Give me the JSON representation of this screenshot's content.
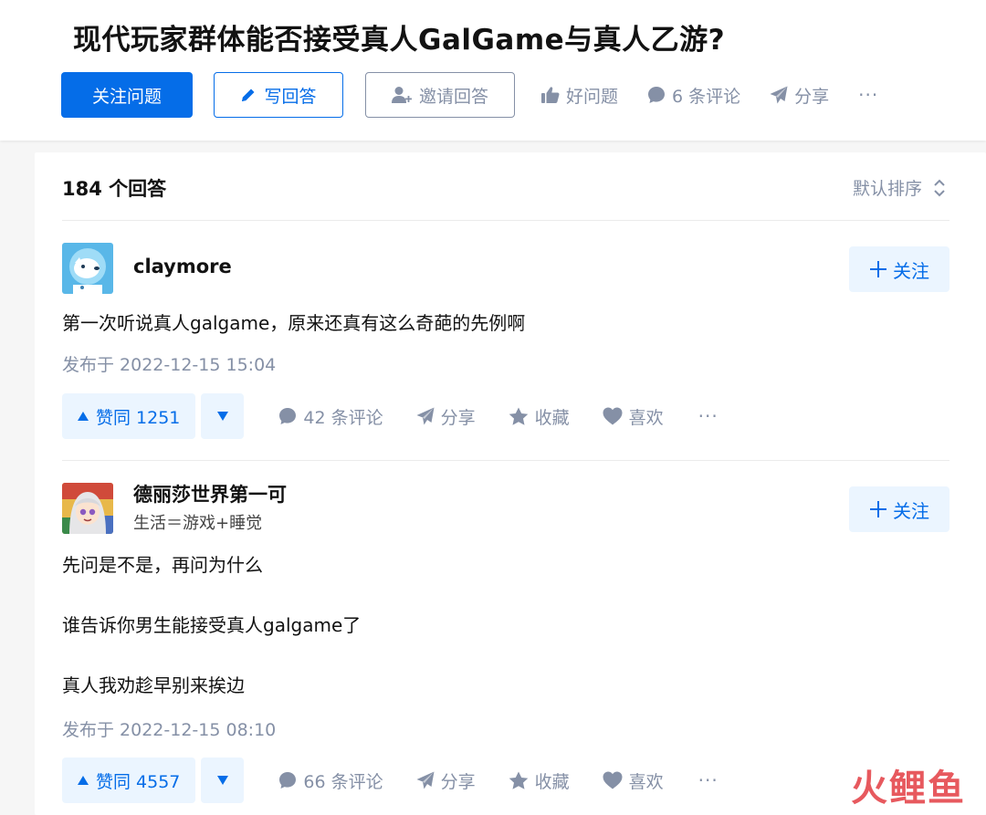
{
  "question": {
    "title": "现代玩家群体能否接受真人GalGame与真人乙游?",
    "follow_label": "关注问题",
    "write_label": "写回答",
    "invite_label": "邀请回答",
    "good_question_label": "好问题",
    "comments_label": "6 条评论",
    "share_label": "分享",
    "more_label": "···"
  },
  "answers_header": {
    "count_label": "184 个回答",
    "sort_label": "默认排序"
  },
  "answers": [
    {
      "author_name": "claymore",
      "author_bio": "",
      "follow_label": "关注",
      "paragraphs": [
        "第一次听说真人galgame，原来还真有这么奇葩的先例啊"
      ],
      "published": "发布于 2022-12-15 15:04",
      "vote_label": "赞同 1251",
      "comments_label": "42 条评论",
      "share_label": "分享",
      "collect_label": "收藏",
      "like_label": "喜欢",
      "more_label": "···"
    },
    {
      "author_name": "德丽莎世界第一可",
      "author_bio": "生活＝游戏+睡觉",
      "follow_label": "关注",
      "paragraphs": [
        "先问是不是，再问为什么",
        "谁告诉你男生能接受真人galgame了",
        "真人我劝趁早别来挨边"
      ],
      "published": "发布于 2022-12-15 08:10",
      "vote_label": "赞同 4557",
      "comments_label": "66 条评论",
      "share_label": "分享",
      "collect_label": "收藏",
      "like_label": "喜欢",
      "more_label": "···"
    }
  ],
  "watermark": {
    "part1": "火",
    "part2": "鲤",
    "part3": "鱼"
  },
  "colors": {
    "brand": "#056de8",
    "brand_light": "#ebf5ff",
    "muted": "#8590a6",
    "watermark": "#e7595e"
  }
}
